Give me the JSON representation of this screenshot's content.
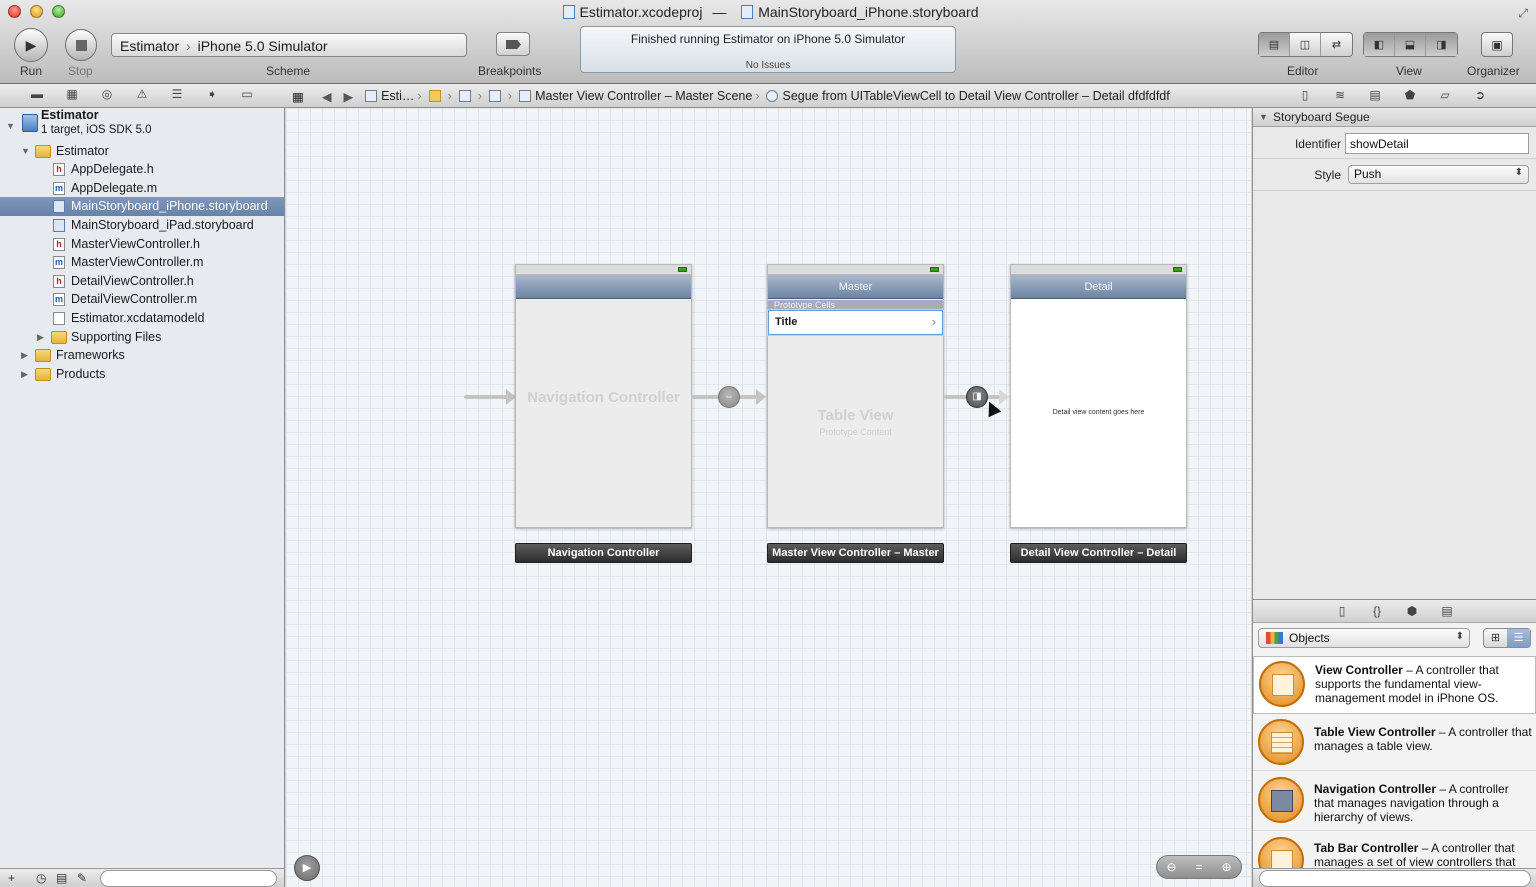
{
  "window": {
    "project_file": "Estimator.xcodeproj",
    "separator": "—",
    "storyboard_file": "MainStoryboard_iPhone.storyboard"
  },
  "toolbar": {
    "run_label": "Run",
    "stop_label": "Stop",
    "scheme_target": "Estimator",
    "scheme_arrow": "›",
    "scheme_destination": "iPhone 5.0 Simulator",
    "scheme_label": "Scheme",
    "breakpoints_label": "Breakpoints",
    "activity_message": "Finished running Estimator on iPhone 5.0 Simulator",
    "activity_issues": "No Issues",
    "editor_label": "Editor",
    "view_label": "View",
    "organizer_label": "Organizer"
  },
  "jump_bar": {
    "project_short": "Esti…",
    "scene": "Master View Controller – Master Scene",
    "segue": "Segue from UITableViewCell to Detail View Controller – Detail dfdfdfdf"
  },
  "navigator": {
    "project_name": "Estimator",
    "project_subtitle": "1 target, iOS SDK 5.0",
    "items": [
      {
        "label": "Estimator",
        "kind": "folder"
      },
      {
        "label": "AppDelegate.h",
        "kind": "h"
      },
      {
        "label": "AppDelegate.m",
        "kind": "m"
      },
      {
        "label": "MainStoryboard_iPhone.storyboard",
        "kind": "storyboard"
      },
      {
        "label": "MainStoryboard_iPad.storyboard",
        "kind": "storyboard"
      },
      {
        "label": "MasterViewController.h",
        "kind": "h"
      },
      {
        "label": "MasterViewController.m",
        "kind": "m"
      },
      {
        "label": "DetailViewController.h",
        "kind": "h"
      },
      {
        "label": "DetailViewController.m",
        "kind": "m"
      },
      {
        "label": "Estimator.xcdatamodeld",
        "kind": "model"
      },
      {
        "label": "Supporting Files",
        "kind": "folder"
      },
      {
        "label": "Frameworks",
        "kind": "folder"
      },
      {
        "label": "Products",
        "kind": "folder"
      }
    ],
    "file_badges": {
      "h": "h",
      "m": "m"
    }
  },
  "storyboard": {
    "nav_controller_placeholder": "Navigation Controller",
    "nav_controller_label": "Navigation Controller",
    "master_nav_title": "Master",
    "master_section_header": "Prototype Cells",
    "master_cell_title": "Title",
    "master_cell_chevron": "›",
    "master_table_title": "Table View",
    "master_table_subtitle": "Prototype Content",
    "master_label": "Master View Controller – Master",
    "detail_nav_title": "Detail",
    "detail_content": "Detail view content goes here",
    "detail_label": "Detail View Controller – Detail"
  },
  "inspector": {
    "section_title": "Storyboard Segue",
    "identifier_label": "Identifier",
    "identifier_value": "showDetail",
    "style_label": "Style",
    "style_value": "Push"
  },
  "library": {
    "selector": "Objects",
    "items": [
      {
        "name": "View Controller",
        "desc": " – A controller that supports the fundamental view-management model in iPhone OS."
      },
      {
        "name": "Table View Controller",
        "desc": " – A controller that manages a table view."
      },
      {
        "name": "Navigation Controller",
        "desc": " – A controller that manages navigation through a hierarchy of views."
      },
      {
        "name": "Tab Bar Controller",
        "desc": " – A controller that manages a set of view controllers that"
      }
    ]
  },
  "colors": {
    "selection": "#6883aa",
    "nav_bar": "#6d84a3",
    "scene_label": "#2d2d2d"
  },
  "icons": [
    "play-icon",
    "stop-icon",
    "breakpoint-icon",
    "folder-icon",
    "file-h-icon",
    "file-m-icon",
    "storyboard-icon",
    "segue-icon",
    "zoom-in-icon",
    "zoom-out-icon"
  ]
}
